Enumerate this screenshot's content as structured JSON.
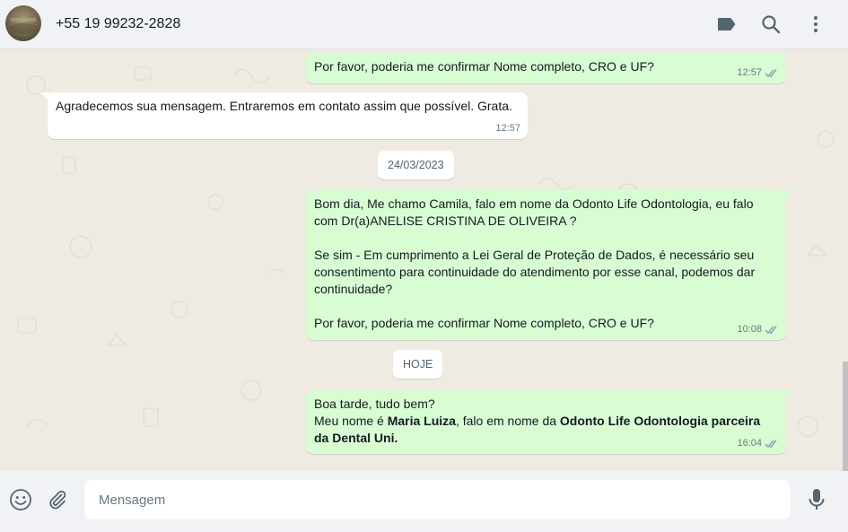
{
  "header": {
    "contact_name": "+55 19 99232-2828",
    "icons": [
      "label-icon",
      "search-icon",
      "menu-icon"
    ]
  },
  "chat": {
    "messages": [
      {
        "direction": "out",
        "lines": [
          "Por favor, poderia me confirmar Nome completo, CRO e UF?"
        ],
        "time": "12:57",
        "status": "double-check"
      },
      {
        "direction": "in",
        "lines": [
          "Agradecemos sua mensagem. Entraremos em contato assim que possível. Grata."
        ],
        "time": "12:57"
      },
      {
        "type": "date",
        "label": "24/03/2023"
      },
      {
        "direction": "out",
        "paragraphs": [
          "Bom dia, Me chamo Camila, falo em nome da Odonto Life Odontologia, eu falo com Dr(a)ANELISE CRISTINA DE OLIVEIRA ?",
          "Se sim - Em cumprimento a Lei Geral de Proteção de Dados, é necessário seu consentimento para continuidade do atendimento por esse canal, podemos dar continuidade?",
          "Por favor, poderia me confirmar Nome completo, CRO e UF?"
        ],
        "time": "10:08",
        "status": "double-check"
      },
      {
        "type": "date",
        "label": "HOJE"
      },
      {
        "direction": "out",
        "line1": "Boa tarde, tudo bem?",
        "line2_parts": [
          "Meu nome é ",
          "Maria Luiza",
          ", falo em nome da ",
          "Odonto Life Odontologia parceira da Dental Uni."
        ],
        "time": "16:04",
        "status": "double-check"
      }
    ]
  },
  "footer": {
    "input_placeholder": "Mensagem",
    "icons": [
      "emoji-icon",
      "attach-icon",
      "mic-icon"
    ]
  },
  "colors": {
    "outgoing_bubble": "#d9fdd3",
    "incoming_bubble": "#ffffff",
    "chat_background": "#efeae2",
    "panel": "#f0f2f5",
    "read_check": "#8696a0"
  }
}
